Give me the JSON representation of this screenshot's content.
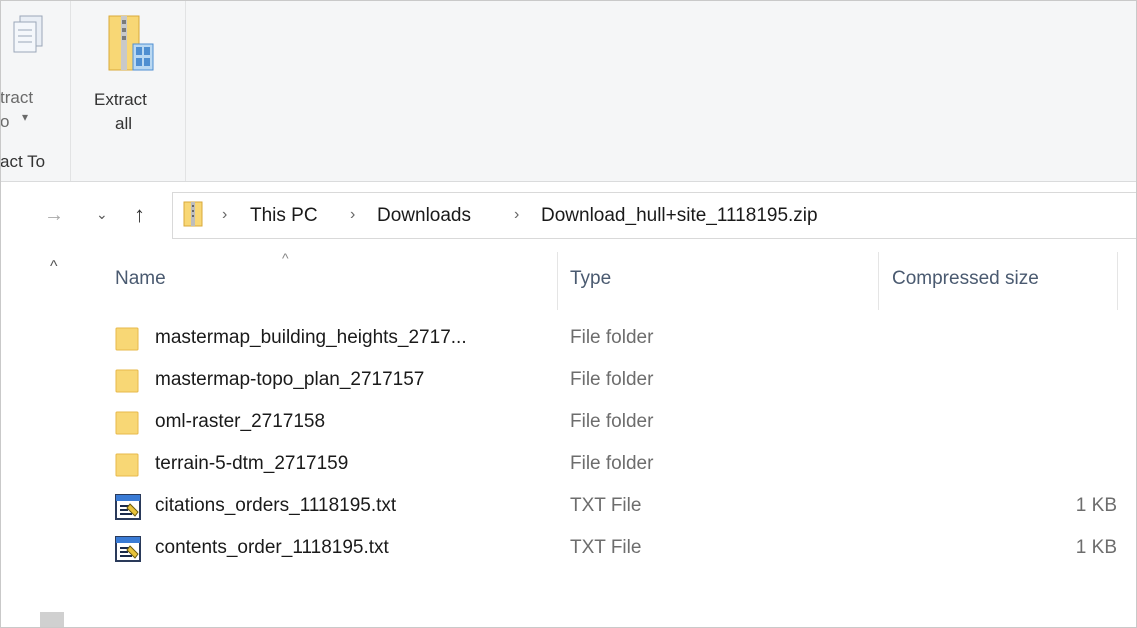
{
  "ribbon": {
    "extract_to_line1": "tract",
    "extract_to_line2": "o",
    "extract_to_group": "act To",
    "extract_all_line1": "Extract",
    "extract_all_line2": "all"
  },
  "breadcrumb": {
    "items": [
      "This PC",
      "Downloads",
      "Download_hull+site_1118195.zip"
    ]
  },
  "columns": {
    "name": "Name",
    "type": "Type",
    "size": "Compressed size"
  },
  "files": [
    {
      "name": "mastermap_building_heights_2717...",
      "type": "File folder",
      "size": "",
      "icon": "folder-icon"
    },
    {
      "name": "mastermap-topo_plan_2717157",
      "type": "File folder",
      "size": "",
      "icon": "folder-icon"
    },
    {
      "name": "oml-raster_2717158",
      "type": "File folder",
      "size": "",
      "icon": "folder-icon"
    },
    {
      "name": "terrain-5-dtm_2717159",
      "type": "File folder",
      "size": "",
      "icon": "folder-icon"
    },
    {
      "name": "citations_orders_1118195.txt",
      "type": "TXT File",
      "size": "1 KB",
      "icon": "text-file-icon"
    },
    {
      "name": "contents_order_1118195.txt",
      "type": "TXT File",
      "size": "1 KB",
      "icon": "text-file-icon"
    }
  ],
  "colors": {
    "folder": "#f8d775",
    "folder_dark": "#e7b84a",
    "header_text": "#4a5a70",
    "ribbon_bg": "#f5f6f7"
  }
}
